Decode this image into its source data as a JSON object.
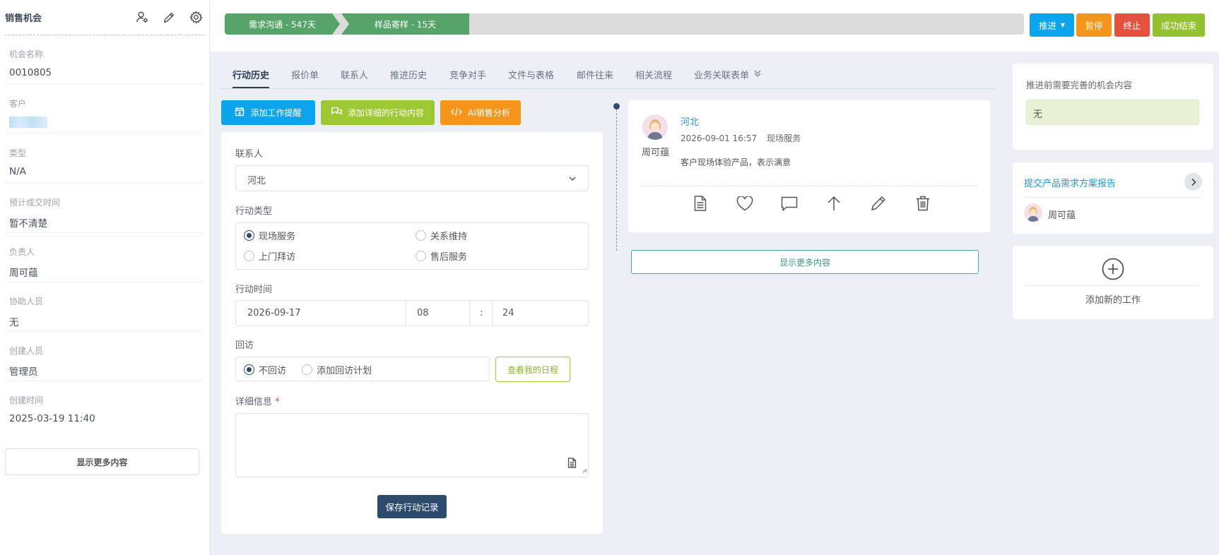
{
  "sidebar": {
    "title": "销售机会",
    "fields": [
      {
        "label": "机会名称",
        "value": "0010805"
      },
      {
        "label": "客户",
        "value": ""
      },
      {
        "label": "类型",
        "value": "N/A"
      },
      {
        "label": "预计成交时间",
        "value": "暂不清楚"
      },
      {
        "label": "负责人",
        "value": "周可蕴"
      },
      {
        "label": "协助人员",
        "value": "无"
      },
      {
        "label": "创建人员",
        "value": "管理员"
      },
      {
        "label": "创建时间",
        "value": "2025-03-19 11:40"
      }
    ],
    "show_more": "显示更多内容",
    "icons": [
      "user-settings-icon",
      "pencil-icon",
      "gear-icon"
    ]
  },
  "pipeline": {
    "stages": [
      {
        "label": "需求沟通 - 547天"
      },
      {
        "label": "样品寄样 - 15天"
      }
    ],
    "colors": {
      "completed_stage": "#57a46a",
      "pending": "#dcdcdc"
    }
  },
  "actions": {
    "advance": "推进",
    "pause": "暂停",
    "terminate": "终止",
    "success": "成功结束",
    "colors": {
      "advance": "#0aa5ec",
      "pause": "#f6951c",
      "terminate": "#e4513f",
      "success": "#93c130"
    }
  },
  "tabs": [
    "行动历史",
    "报价单",
    "联系人",
    "推进历史",
    "竞争对手",
    "文件与表格",
    "邮件往来",
    "相关流程",
    "业务关联表单"
  ],
  "add_buttons": {
    "reminder": "添加工作提醒",
    "detail": "添加详细的行动内容",
    "ai": "AI销售分析"
  },
  "form": {
    "contact_label": "联系人",
    "contact_value": "河北",
    "action_type_label": "行动类型",
    "action_types": [
      "现场服务",
      "关系维持",
      "上门拜访",
      "售后服务"
    ],
    "selected_action_type": "现场服务",
    "time_label": "行动时间",
    "date": "2026-09-17",
    "hour": "08",
    "separator": ":",
    "minute": "24",
    "revisit_label": "回访",
    "revisit_options": [
      "不回访",
      "添加回访计划"
    ],
    "selected_revisit": "不回访",
    "schedule_button": "查看我的日程",
    "detail_label": "详细信息",
    "required_mark": "*",
    "save_button": "保存行动记录"
  },
  "history": {
    "entries": [
      {
        "contact": "河北",
        "time": "2026-09-01 16:57",
        "type": "现场服务",
        "content": "客户现场体验产品，表示满意",
        "author": "周可蕴"
      }
    ],
    "icons": [
      "document-icon",
      "heart-icon",
      "comment-icon",
      "arrow-up-icon",
      "pencil-icon",
      "trash-icon"
    ],
    "show_more": "显示更多内容"
  },
  "right": {
    "prereq_title": "推进前需要完善的机会内容",
    "prereq_value": "无",
    "task_title": "提交产品需求方案报告",
    "task_user": "周可蕴",
    "add_work": "添加新的工作"
  }
}
